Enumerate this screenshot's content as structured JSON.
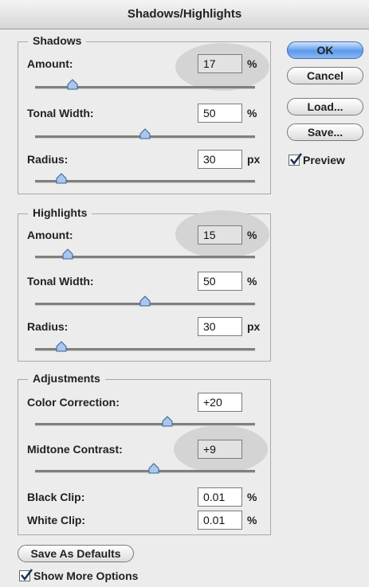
{
  "window": {
    "title": "Shadows/Highlights"
  },
  "shadows": {
    "legend": "Shadows",
    "amount": {
      "label": "Amount:",
      "value": "17",
      "unit": "%",
      "slider_level": 0.17
    },
    "tonal_width": {
      "label": "Tonal Width:",
      "value": "50",
      "unit": "%",
      "slider_level": 0.5
    },
    "radius": {
      "label": "Radius:",
      "value": "30",
      "unit": "px",
      "slider_level": 0.12
    }
  },
  "highlights": {
    "legend": "Highlights",
    "amount": {
      "label": "Amount:",
      "value": "15",
      "unit": "%",
      "slider_level": 0.15
    },
    "tonal_width": {
      "label": "Tonal Width:",
      "value": "50",
      "unit": "%",
      "slider_level": 0.5
    },
    "radius": {
      "label": "Radius:",
      "value": "30",
      "unit": "px",
      "slider_level": 0.12
    }
  },
  "adjustments": {
    "legend": "Adjustments",
    "color_correction": {
      "label": "Color Correction:",
      "value": "+20",
      "slider_level": 0.6
    },
    "midtone_contrast": {
      "label": "Midtone Contrast:",
      "value": "+9",
      "slider_level": 0.54
    },
    "black_clip": {
      "label": "Black Clip:",
      "value": "0.01",
      "unit": "%"
    },
    "white_clip": {
      "label": "White Clip:",
      "value": "0.01",
      "unit": "%"
    }
  },
  "buttons": {
    "ok": "OK",
    "cancel": "Cancel",
    "load": "Load...",
    "save": "Save...",
    "save_defaults": "Save As Defaults"
  },
  "preview": {
    "label": "Preview",
    "checked": true
  },
  "show_more_options": {
    "label": "Show More Options",
    "checked": true
  },
  "colors": {
    "accent": "#5d9aea",
    "halo": "#d2d2d2",
    "background": "#ececec"
  },
  "icons": {
    "slider_thumb": "slider-thumb-icon",
    "checkmark": "checkmark-icon"
  }
}
